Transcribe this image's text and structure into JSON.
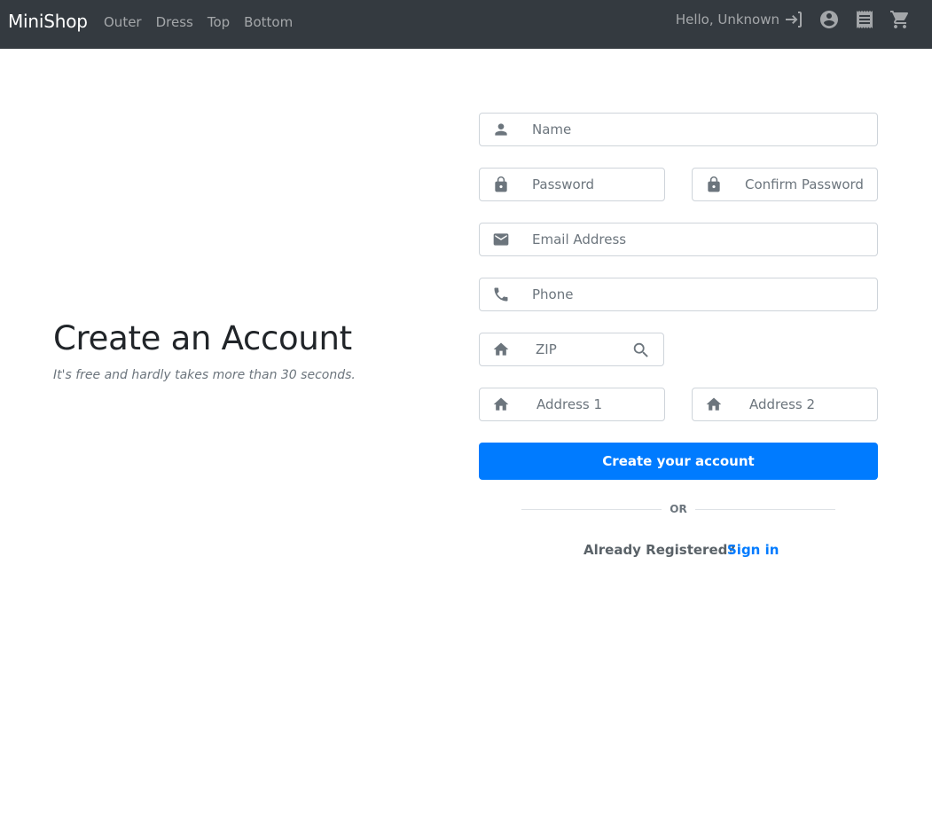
{
  "navbar": {
    "brand": "MiniShop",
    "links": [
      "Outer",
      "Dress",
      "Top",
      "Bottom"
    ],
    "greeting": "Hello, Unknown",
    "icons": [
      "login-icon",
      "account-circle-icon",
      "receipt-icon",
      "cart-icon"
    ]
  },
  "hero": {
    "title": "Create an Account",
    "subtitle": "It's free and hardly takes more than 30 seconds."
  },
  "form": {
    "name_placeholder": "Name",
    "password_placeholder": "Password",
    "confirm_password_placeholder": "Confirm Password",
    "email_placeholder": "Email Address",
    "phone_placeholder": "Phone",
    "zip_placeholder": "ZIP",
    "address1_placeholder": "Address 1",
    "address2_placeholder": "Address 2",
    "submit_label": "Create your account",
    "divider_label": "OR",
    "already_registered": "Already Registered?",
    "signin_label": "Sign in"
  },
  "colors": {
    "navbar_bg": "#343a40",
    "primary": "#007bff",
    "icon_gray": "#6c757d"
  }
}
